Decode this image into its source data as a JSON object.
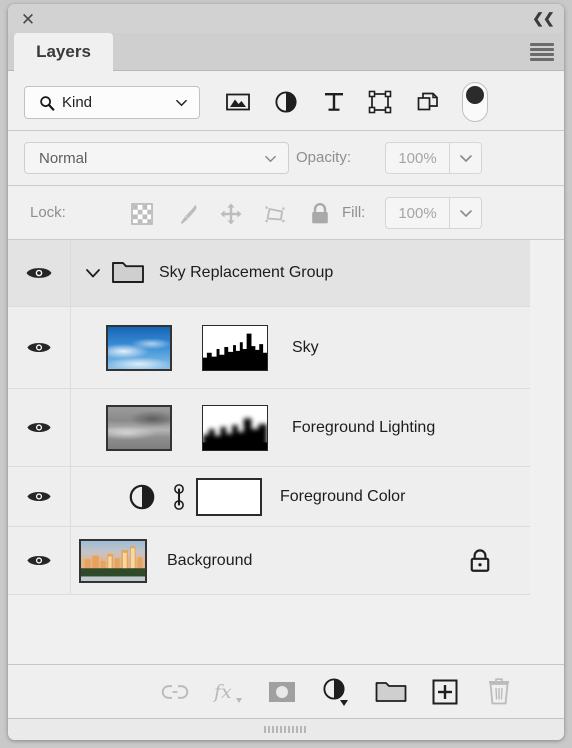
{
  "window": {
    "close_icon": "close-icon",
    "collapse_icon": "double-chevron-left-icon",
    "tab_label": "Layers",
    "menu_icon": "hamburger-menu-icon"
  },
  "filter_bar": {
    "search_icon": "search-icon",
    "kind_label": "Kind",
    "caret_icon": "chevron-down-icon",
    "tools": [
      {
        "name": "filter-pixel-layers",
        "icon": "image-icon"
      },
      {
        "name": "filter-adjustment-layers",
        "icon": "half-circle-icon"
      },
      {
        "name": "filter-type-layers",
        "icon": "text-t-icon"
      },
      {
        "name": "filter-shape-layers",
        "icon": "shape-bounding-box-icon"
      },
      {
        "name": "filter-smart-objects",
        "icon": "smart-object-icon"
      }
    ],
    "toggle": {
      "name": "filter-enable-toggle",
      "state": "off"
    }
  },
  "blend_bar": {
    "blend_mode": "Normal",
    "blend_caret": "chevron-down-icon",
    "opacity_label": "Opacity:",
    "opacity_value": "100%",
    "opacity_caret": "chevron-down-icon"
  },
  "lock_bar": {
    "lock_label": "Lock:",
    "tools": [
      {
        "name": "lock-transparent-pixels",
        "icon": "checkerboard-icon"
      },
      {
        "name": "lock-image-pixels",
        "icon": "paintbrush-icon"
      },
      {
        "name": "lock-position",
        "icon": "move-arrows-icon"
      },
      {
        "name": "lock-artboard-nesting",
        "icon": "artboard-icon"
      },
      {
        "name": "lock-all",
        "icon": "lock-icon"
      }
    ],
    "fill_label": "Fill:",
    "fill_value": "100%",
    "fill_caret": "chevron-down-icon"
  },
  "layers": [
    {
      "name": "Sky Replacement Group",
      "type": "group",
      "visible": true,
      "expanded": true,
      "selected": false,
      "eye_icon": "eye-icon",
      "disclosure_icon": "chevron-down-icon",
      "folder_icon": "folder-icon",
      "locked": false
    },
    {
      "name": "Sky",
      "type": "pixel",
      "visible": true,
      "selected": false,
      "eye_icon": "eye-icon",
      "thumbnail": "blue-sky-thumbnail",
      "mask": "city-skyline-mask",
      "locked": false
    },
    {
      "name": "Foreground Lighting",
      "type": "pixel",
      "visible": true,
      "selected": false,
      "eye_icon": "eye-icon",
      "thumbnail": "gray-gradient-thumbnail",
      "mask": "soft-skyline-gradient-mask",
      "locked": false
    },
    {
      "name": "Foreground Color",
      "type": "adjustment",
      "visible": true,
      "selected": false,
      "eye_icon": "eye-icon",
      "adjustment_icon": "half-circle-icon",
      "link_icon": "link-mask-icon",
      "swatch": "#ffffff",
      "locked": false
    },
    {
      "name": "Background",
      "type": "background",
      "visible": true,
      "selected": false,
      "eye_icon": "eye-icon",
      "thumbnail": "city-skyline-dusk-thumbnail",
      "locked": true,
      "lock_icon": "lock-icon"
    }
  ],
  "bottom_bar": {
    "tools": [
      {
        "name": "link-layers-button",
        "icon": "chain-link-icon",
        "enabled": false
      },
      {
        "name": "layer-style-button",
        "icon": "fx-icon",
        "enabled": false
      },
      {
        "name": "add-layer-mask-button",
        "icon": "mask-icon",
        "enabled": true
      },
      {
        "name": "new-adjustment-layer-button",
        "icon": "half-circle-icon",
        "enabled": true
      },
      {
        "name": "new-group-button",
        "icon": "folder-icon",
        "enabled": true
      },
      {
        "name": "new-layer-button",
        "icon": "plus-square-icon",
        "enabled": true
      },
      {
        "name": "delete-layer-button",
        "icon": "trash-icon",
        "enabled": false
      }
    ]
  },
  "resize_grip": {
    "name": "resize-grip",
    "icon": "grip-lines-icon"
  },
  "colors": {
    "panel_bg": "#f0f0f0",
    "titlebar_bg": "#d2d2d2",
    "tab_active_bg": "#f0f0f0",
    "row_bg": "#eeeeee",
    "text": "#1d1d1d",
    "muted_text": "#8e8e8e",
    "sky_blue": "#3a8ed6"
  }
}
